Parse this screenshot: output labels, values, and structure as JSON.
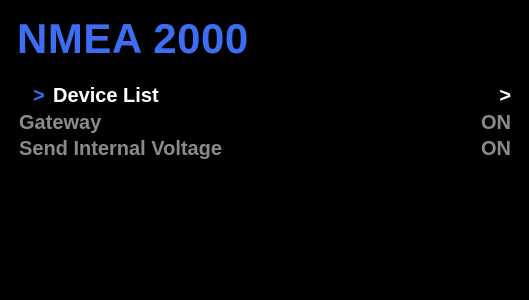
{
  "colors": {
    "background": "#000000",
    "title": "#3d6df2",
    "cursor": "#3d6df2",
    "selected_text": "#ffffff",
    "inactive_text": "#8a8a8a"
  },
  "header": {
    "title": "NMEA 2000"
  },
  "menu": {
    "cursor_glyph": ">",
    "items": [
      {
        "label": "Device List",
        "value": ">",
        "selected": true
      },
      {
        "label": "Gateway",
        "value": "ON",
        "selected": false
      },
      {
        "label": "Send Internal Voltage",
        "value": "ON",
        "selected": false
      }
    ]
  }
}
